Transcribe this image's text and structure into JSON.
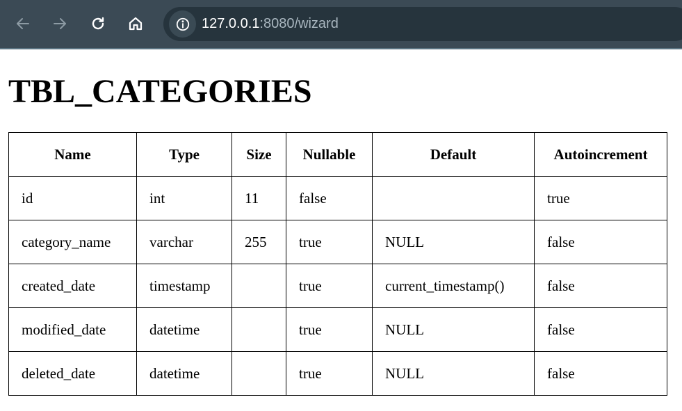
{
  "browser": {
    "url_host": "127.0.0.1",
    "url_rest": ":8080/wizard"
  },
  "page": {
    "title": "TBL_CATEGORIES"
  },
  "table": {
    "headers": [
      "Name",
      "Type",
      "Size",
      "Nullable",
      "Default",
      "Autoincrement"
    ],
    "rows": [
      [
        "id",
        "int",
        "11",
        "false",
        "",
        "true"
      ],
      [
        "category_name",
        "varchar",
        "255",
        "true",
        "NULL",
        "false"
      ],
      [
        "created_date",
        "timestamp",
        "",
        "true",
        "current_timestamp()",
        "false"
      ],
      [
        "modified_date",
        "datetime",
        "",
        "true",
        "NULL",
        "false"
      ],
      [
        "deleted_date",
        "datetime",
        "",
        "true",
        "NULL",
        "false"
      ]
    ]
  },
  "colors": {
    "toolbar_bg": "#3b4a55",
    "omnibox_bg": "#26343d"
  },
  "icons": [
    "back-arrow-icon",
    "forward-arrow-icon",
    "reload-icon",
    "home-icon",
    "site-info-icon"
  ]
}
